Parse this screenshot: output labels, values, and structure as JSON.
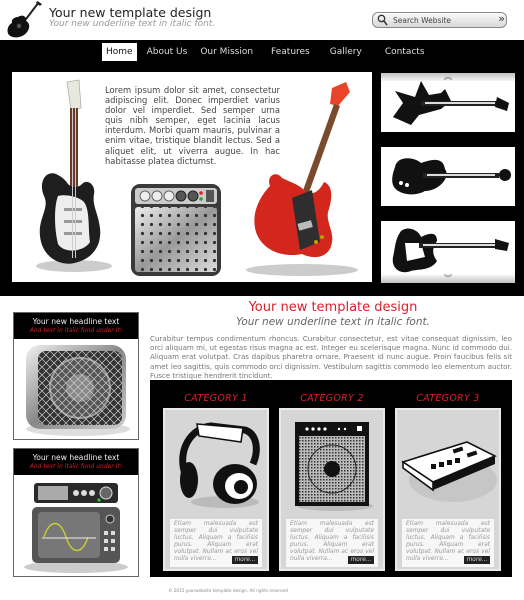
{
  "header": {
    "title": "Your new template design",
    "subtitle": "Your new underline text in italic font.",
    "logo_icon": "acoustic-guitar-icon",
    "search": {
      "placeholder": "Search Website",
      "icon": "magnifier-icon",
      "submit_icon": "double-chevron-right-icon",
      "submit_glyph": "»"
    }
  },
  "nav": {
    "items": [
      {
        "label": "Home",
        "active": true
      },
      {
        "label": "About Us",
        "active": false
      },
      {
        "label": "Our Mission",
        "active": false
      },
      {
        "label": "Features",
        "active": false
      },
      {
        "label": "Gallery",
        "active": false
      },
      {
        "label": "Contacts",
        "active": false
      }
    ]
  },
  "hero": {
    "text": "Lorem ipsum dolor sit amet, consectetur adipiscing elit. Donec imperdiet varius dolor vel imperdiet. Sed semper urna quis nibh semper, eget lacinia lacus interdum. Morbi quam mauris, pulvinar a enim vitae, tristique blandit lectus. Sed a aliquet elit, ut viverra augue. In hac habitasse platea dictumst.",
    "images": [
      "electric-guitar-black",
      "guitar-amplifier",
      "electric-guitar-red"
    ]
  },
  "thumbs": {
    "up_glyph": "︽",
    "down_glyph": "︾",
    "items": [
      "flying-v-guitar",
      "hollow-body-guitar",
      "solid-body-guitar"
    ]
  },
  "sidebar": {
    "boxes": [
      {
        "headline": "Your new headline text",
        "subline": "And text in italic fond under it!",
        "image": "speaker-icon"
      },
      {
        "headline": "Your new headline text",
        "subline": "And text in italic fond under it!",
        "image": "oscilloscope-tv-icon"
      }
    ]
  },
  "main": {
    "title": "Your new template design",
    "subtitle": "Your new underline text in italic font.",
    "text": "Curabitur tempus condimentum rhoncus. Curabitur consectetur, est vitae consequat dignissim, leo orci aliquam mi, ut egestas risus magna ac est. Integer eu scelerisque magna. Nunc id commodo dui. Aliquam erat volutpat. Cras dapibus pharetra ornare. Praesent id nunc augue. Proin faucibus felis sit amet leo sagittis, quis commodo orci dignissim. Vestibulum sagittis commodo leo elementum auctor. Fusce tristique hendrerit tincidunt."
  },
  "categories": [
    {
      "title": "CATEGORY 1",
      "image": "headphones-icon",
      "text": "Etiam malesuada est semper dui vulputate luctus. Aliquam a facilisis purus. Aliquam erat volutpat. Nullam ac eros vel nulla viverra...",
      "more": "more..."
    },
    {
      "title": "CATEGORY 2",
      "image": "amplifier-icon",
      "text": "Etiam malesuada est semper dui vulputate luctus. Aliquam a facilisis purus. Aliquam erat volutpat. Nullam ac eros vel nulla viverra...",
      "more": "more..."
    },
    {
      "title": "CATEGORY 3",
      "image": "mixer-console-icon",
      "text": "Etiam malesuada est semper dui vulputate luctus. Aliquam a facilisis purus. Aliquam erat volutpat. Nullam ac eros vel nulla viverra...",
      "more": "more..."
    }
  ],
  "footer": {
    "text": "© 2015 yourwebsite template design. All rights reserved"
  },
  "colors": {
    "accent_red": "#d8212c",
    "band_black": "#000000",
    "card_gray": "#d6d6d6"
  }
}
